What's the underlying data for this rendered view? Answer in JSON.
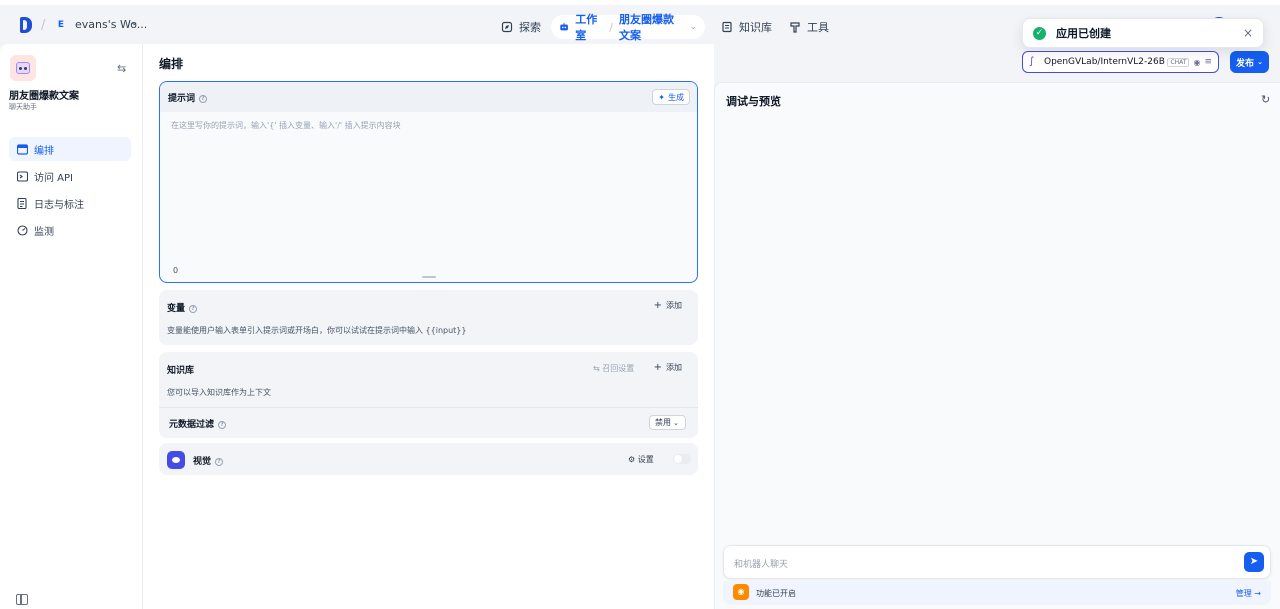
{
  "workspace": {
    "badge": "E",
    "name": "evans's Wo..."
  },
  "nav": {
    "explore": "探索",
    "studio": "工作室",
    "current_app": "朋友圈爆款文案",
    "knowledge": "知识库",
    "tools": "工具"
  },
  "toast": {
    "message": "应用已创建",
    "close": "×"
  },
  "app": {
    "name": "朋友圈爆款文案",
    "type": "聊天助手"
  },
  "sidebar": {
    "items": [
      {
        "label": "编排",
        "icon": "layout-icon",
        "active": true
      },
      {
        "label": "访问 API",
        "icon": "terminal-icon",
        "active": false
      },
      {
        "label": "日志与标注",
        "icon": "log-icon",
        "active": false
      },
      {
        "label": "监测",
        "icon": "monitor-icon",
        "active": false
      }
    ]
  },
  "editor": {
    "title": "编排",
    "prompt": {
      "label": "提示词",
      "generate": "生成",
      "placeholder": "在这里写你的提示词，输入'{' 插入变量、输入'/' 插入提示内容块",
      "count": "0"
    },
    "variables": {
      "title": "变量",
      "add": "添加",
      "description": "变量能使用户输入表单引入提示词或开场白，你可以试试在提示词中输入 {{input}}"
    },
    "knowledge": {
      "title": "知识库",
      "recall": "召回设置",
      "add": "添加",
      "description": "您可以导入知识库作为上下文",
      "metadata_filter": "元数据过滤",
      "metadata_value": "禁用"
    },
    "vision": {
      "title": "视觉",
      "settings": "设置",
      "enabled": false
    }
  },
  "model": {
    "name": "OpenGVLab/InternVL2-26B",
    "tag": "CHAT"
  },
  "publish": "发布",
  "debug": {
    "title": "调试与预览",
    "chat_placeholder": "和机器人聊天",
    "feature_text": "功能已开启",
    "manage": "管理"
  },
  "colors": {
    "accent": "#155eef",
    "success": "#17b26a",
    "vision": "#444ce7",
    "feature": "#ff8a00"
  }
}
